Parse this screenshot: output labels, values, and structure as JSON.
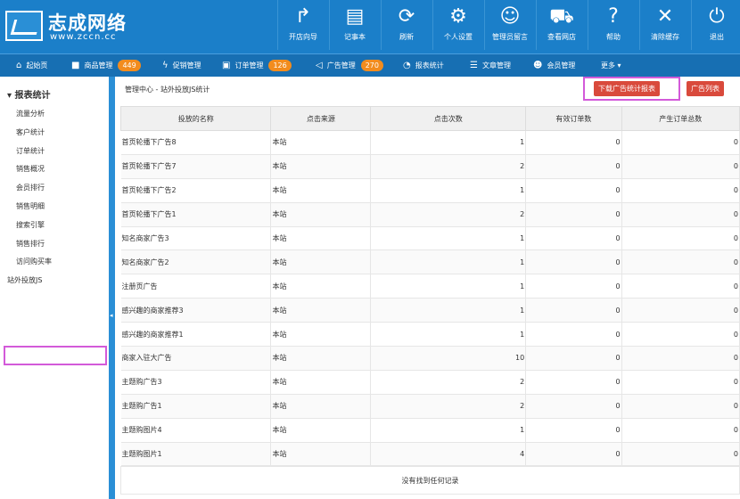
{
  "brand": {
    "name": "志成网络",
    "url": "www.zccn.cc"
  },
  "toolbar": [
    {
      "label": "开店向导",
      "icon": "share-arrow-icon",
      "glyph": "↱"
    },
    {
      "label": "记事本",
      "icon": "notepad-icon",
      "glyph": "▤"
    },
    {
      "label": "刷新",
      "icon": "refresh-icon",
      "glyph": "⟳"
    },
    {
      "label": "个人设置",
      "icon": "gear-icon",
      "glyph": "⚙"
    },
    {
      "label": "管理员留言",
      "icon": "message-icon",
      "glyph": "☺"
    },
    {
      "label": "查看网店",
      "icon": "cart-icon",
      "glyph": "⛟"
    },
    {
      "label": "帮助",
      "icon": "help-icon",
      "glyph": "?"
    },
    {
      "label": "清除缓存",
      "icon": "clear-icon",
      "glyph": "✕"
    },
    {
      "label": "退出",
      "icon": "power-icon",
      "glyph": "⏻"
    }
  ],
  "nav": [
    {
      "label": "起始页",
      "icon": "home-icon",
      "glyph": "⌂",
      "badge": ""
    },
    {
      "label": "商品管理",
      "icon": "goods-icon",
      "glyph": "■",
      "badge": "449"
    },
    {
      "label": "促销管理",
      "icon": "bolt-icon",
      "glyph": "ϟ",
      "badge": ""
    },
    {
      "label": "订单管理",
      "icon": "order-icon",
      "glyph": "▣",
      "badge": "126"
    },
    {
      "label": "广告管理",
      "icon": "ad-icon",
      "glyph": "◁",
      "badge": "270"
    },
    {
      "label": "报表统计",
      "icon": "chart-icon",
      "glyph": "◔",
      "badge": ""
    },
    {
      "label": "文章管理",
      "icon": "article-icon",
      "glyph": "☰",
      "badge": ""
    },
    {
      "label": "会员管理",
      "icon": "member-icon",
      "glyph": "☻",
      "badge": ""
    },
    {
      "label": "更多",
      "icon": "more-icon",
      "glyph": "",
      "badge": ""
    }
  ],
  "sidebar": {
    "heading": "报表统计",
    "items": [
      "流量分析",
      "客户统计",
      "订单统计",
      "销售概况",
      "会员排行",
      "销售明细",
      "搜索引擎",
      "销售排行",
      "访问购买率",
      "站外投放JS"
    ],
    "active": "站外投放JS"
  },
  "breadcrumb": {
    "root": "管理中心",
    "sep": " - ",
    "current": "站外投放JS统计"
  },
  "buttons": {
    "download": "下载广告统计报表",
    "ad_list": "广告列表"
  },
  "table": {
    "headers": [
      "投放的名称",
      "点击来源",
      "点击次数",
      "有效订单数",
      "产生订单总数"
    ],
    "rows": [
      [
        "首页轮播下广告8",
        "本站",
        "1",
        "0",
        "0"
      ],
      [
        "首页轮播下广告7",
        "本站",
        "2",
        "0",
        "0"
      ],
      [
        "首页轮播下广告2",
        "本站",
        "1",
        "0",
        "0"
      ],
      [
        "首页轮播下广告1",
        "本站",
        "2",
        "0",
        "0"
      ],
      [
        "知名商家广告3",
        "本站",
        "1",
        "0",
        "0"
      ],
      [
        "知名商家广告2",
        "本站",
        "1",
        "0",
        "0"
      ],
      [
        "注册页广告",
        "本站",
        "1",
        "0",
        "0"
      ],
      [
        "感兴趣的商家推荐3",
        "本站",
        "1",
        "0",
        "0"
      ],
      [
        "感兴趣的商家推荐1",
        "本站",
        "1",
        "0",
        "0"
      ],
      [
        "商家入驻大广告",
        "本站",
        "10",
        "0",
        "0"
      ],
      [
        "主题购广告3",
        "本站",
        "2",
        "0",
        "0"
      ],
      [
        "主题购广告1",
        "本站",
        "2",
        "0",
        "0"
      ],
      [
        "主题购图片4",
        "本站",
        "1",
        "0",
        "0"
      ],
      [
        "主题购图片1",
        "本站",
        "4",
        "0",
        "0"
      ]
    ],
    "empty_text": "没有找到任何记录"
  }
}
